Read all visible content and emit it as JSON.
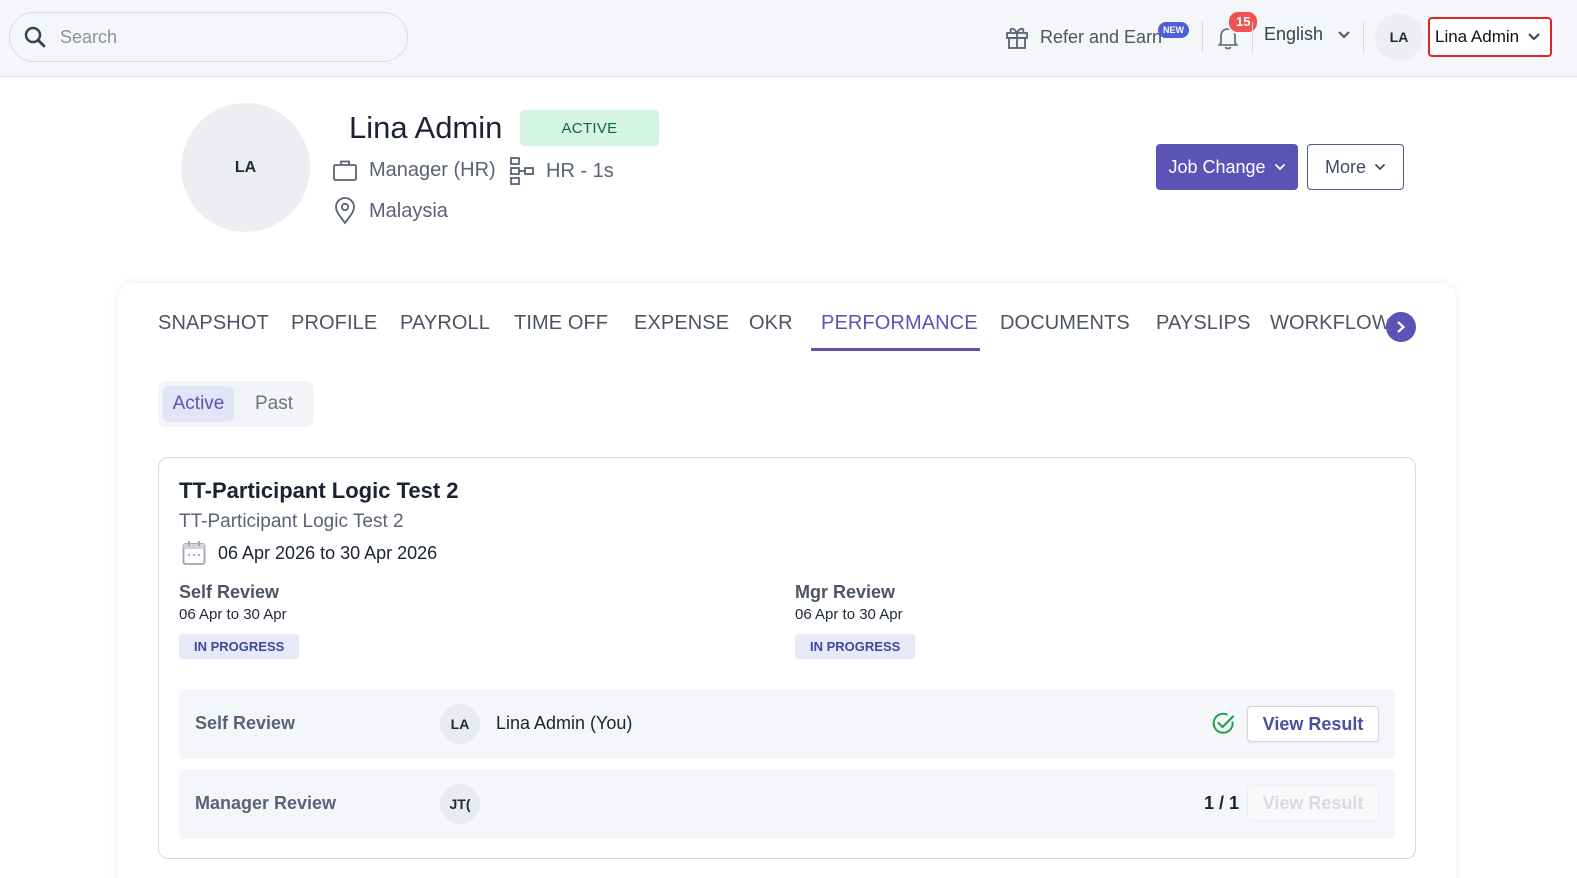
{
  "topbar": {
    "search_placeholder": "Search",
    "refer_label": "Refer and Earn",
    "new_badge": "NEW",
    "notification_count": "15",
    "language": "English",
    "avatar_initials": "LA",
    "user_name": "Lina Admin"
  },
  "profile": {
    "avatar_initials": "LA",
    "name": "Lina Admin",
    "status": "ACTIVE",
    "designation": "Manager (HR)",
    "department": "HR - 1s",
    "location": "Malaysia",
    "job_change_label": "Job Change",
    "more_label": "More"
  },
  "tabs": [
    "SNAPSHOT",
    "PROFILE",
    "PAYROLL",
    "TIME OFF",
    "EXPENSE",
    "OKR",
    "PERFORMANCE",
    "DOCUMENTS",
    "PAYSLIPS",
    "WORKFLOW"
  ],
  "active_tab": "PERFORMANCE",
  "segments": {
    "active": "Active",
    "past": "Past"
  },
  "review": {
    "title": "TT-Participant Logic Test 2",
    "subtitle": "TT-Participant Logic Test 2",
    "date_range": "06 Apr 2026 to 30 Apr 2026",
    "phases": [
      {
        "title": "Self Review",
        "dates": "06 Apr to 30 Apr",
        "status": "IN PROGRESS"
      },
      {
        "title": "Mgr Review",
        "dates": "06 Apr to 30 Apr",
        "status": "IN PROGRESS"
      }
    ],
    "rows": [
      {
        "label": "Self Review",
        "initials": "LA",
        "name": "Lina Admin (You)",
        "button": "View Result"
      },
      {
        "label": "Manager Review",
        "initials": "JT(",
        "progress": "1 / 1",
        "button": "View Result"
      }
    ]
  },
  "colors": {
    "accent": "#5b53b5",
    "active_badge_bg": "#d4f5e4",
    "highlight_border": "#e02424",
    "notification": "#f05252"
  }
}
